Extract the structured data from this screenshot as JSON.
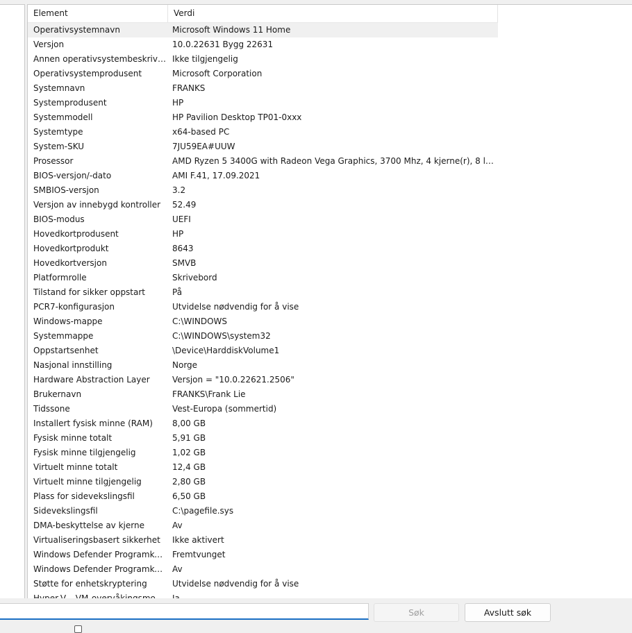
{
  "table": {
    "columns": [
      "Element",
      "Verdi"
    ],
    "rows": [
      [
        "Operativsystemnavn",
        "Microsoft Windows 11 Home"
      ],
      [
        "Versjon",
        "10.0.22631 Bygg 22631"
      ],
      [
        "Annen operativsystembeskrivel...",
        "Ikke tilgjengelig"
      ],
      [
        "Operativsystemprodusent",
        "Microsoft Corporation"
      ],
      [
        "Systemnavn",
        "FRANKS"
      ],
      [
        "Systemprodusent",
        "HP"
      ],
      [
        "Systemmodell",
        "HP Pavilion Desktop TP01-0xxx"
      ],
      [
        "Systemtype",
        "x64-based PC"
      ],
      [
        "System-SKU",
        "7JU59EA#UUW"
      ],
      [
        "Prosessor",
        "AMD Ryzen 5 3400G with Radeon Vega Graphics, 3700 Mhz, 4 kjerne(r), 8 logi..."
      ],
      [
        "BIOS-versjon/-dato",
        "AMI F.41, 17.09.2021"
      ],
      [
        "SMBIOS-versjon",
        "3.2"
      ],
      [
        "Versjon av innebygd kontroller",
        "52.49"
      ],
      [
        "BIOS-modus",
        "UEFI"
      ],
      [
        "Hovedkortprodusent",
        "HP"
      ],
      [
        "Hovedkortprodukt",
        "8643"
      ],
      [
        "Hovedkortversjon",
        "SMVB"
      ],
      [
        "Platformrolle",
        "Skrivebord"
      ],
      [
        "Tilstand for sikker oppstart",
        "På"
      ],
      [
        "PCR7-konfigurasjon",
        "Utvidelse nødvendig for å vise"
      ],
      [
        "Windows-mappe",
        "C:\\WINDOWS"
      ],
      [
        "Systemmappe",
        "C:\\WINDOWS\\system32"
      ],
      [
        "Oppstartsenhet",
        "\\Device\\HarddiskVolume1"
      ],
      [
        "Nasjonal innstilling",
        "Norge"
      ],
      [
        "Hardware Abstraction Layer",
        "Versjon = \"10.0.22621.2506\""
      ],
      [
        "Brukernavn",
        "FRANKS\\Frank Lie"
      ],
      [
        "Tidssone",
        "Vest-Europa (sommertid)"
      ],
      [
        "Installert fysisk minne (RAM)",
        "8,00 GB"
      ],
      [
        "Fysisk minne totalt",
        "5,91 GB"
      ],
      [
        "Fysisk minne tilgjengelig",
        "1,02 GB"
      ],
      [
        "Virtuelt minne totalt",
        "12,4 GB"
      ],
      [
        "Virtuelt minne tilgjengelig",
        "2,80 GB"
      ],
      [
        "Plass for sidevekslingsfil",
        "6,50 GB"
      ],
      [
        "Sidevekslingsfil",
        "C:\\pagefile.sys"
      ],
      [
        "DMA-beskyttelse av kjerne",
        "Av"
      ],
      [
        "Virtualiseringsbasert sikkerhet",
        "Ikke aktivert"
      ],
      [
        "Windows Defender Programko...",
        "Fremtvunget"
      ],
      [
        "Windows Defender Programko...",
        "Av"
      ],
      [
        "Støtte for enhetskryptering",
        "Utvidelse nødvendig for å vise"
      ],
      [
        "Hyper-V – VM-overvåkingsmo...",
        "Ja"
      ]
    ]
  },
  "search": {
    "value": "",
    "search_button": "Søk",
    "close_button": "Avslutt søk"
  }
}
